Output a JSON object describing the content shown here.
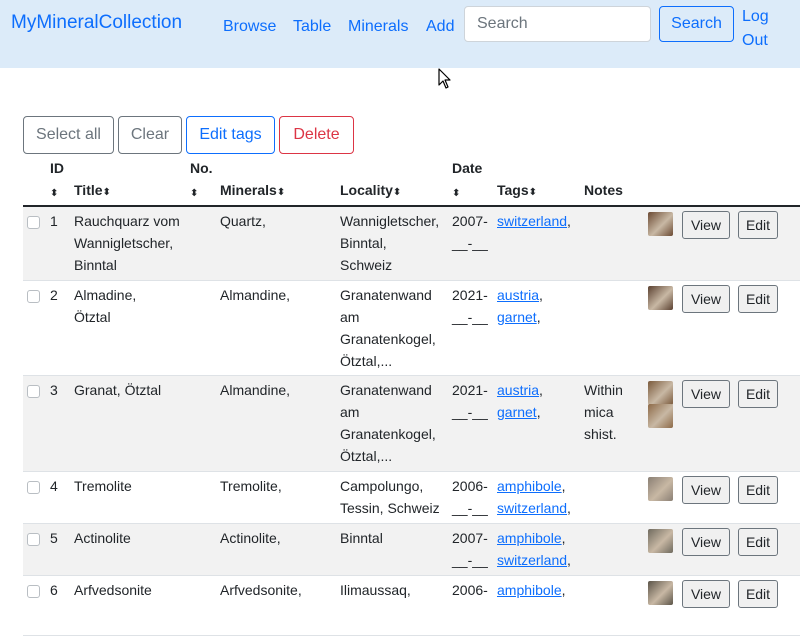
{
  "navbar": {
    "brand": "MyMineralCollection",
    "links": [
      "Browse",
      "Table",
      "Minerals",
      "Add"
    ],
    "search_placeholder": "Search",
    "search_button": "Search",
    "logout_line1": "Log",
    "logout_line2": "Out"
  },
  "actions": {
    "select_all": "Select all",
    "clear": "Clear",
    "edit_tags": "Edit tags",
    "delete": "Delete"
  },
  "table": {
    "headers": {
      "id": "ID",
      "title": "Title",
      "no": "No.",
      "minerals": "Minerals",
      "locality": "Locality",
      "date": "Date",
      "tags": "Tags",
      "notes": "Notes"
    },
    "sort_icon": "sort-arrows",
    "rows": [
      {
        "id": "1",
        "title_lines": [
          "Rauchquarz vom",
          "Wannigletscher,",
          "Binntal"
        ],
        "minerals": "Quartz,",
        "locality_lines": [
          "Wannigletscher,",
          "Binntal,",
          "Schweiz"
        ],
        "date_lines": [
          "2007-",
          "__-__"
        ],
        "tags": [
          "switzerland"
        ],
        "notes_lines": [],
        "thumbs": 1,
        "view": "View",
        "edit": "Edit"
      },
      {
        "id": "2",
        "title_lines": [
          "Almadine,",
          "Ötztal"
        ],
        "minerals": "Almandine,",
        "locality_lines": [
          "Granatenwand",
          "am",
          "Granatenkogel,",
          "Ötztal,..."
        ],
        "date_lines": [
          "2021-",
          "__-__"
        ],
        "tags": [
          "austria",
          "garnet"
        ],
        "notes_lines": [],
        "thumbs": 1,
        "view": "View",
        "edit": "Edit"
      },
      {
        "id": "3",
        "title_lines": [
          "Granat, Ötztal"
        ],
        "minerals": "Almandine,",
        "locality_lines": [
          "Granatenwand",
          "am",
          "Granatenkogel,",
          "Ötztal,..."
        ],
        "date_lines": [
          "2021-",
          "__-__"
        ],
        "tags": [
          "austria",
          "garnet"
        ],
        "notes_lines": [
          "Within",
          "mica",
          "shist."
        ],
        "thumbs": 2,
        "view": "View",
        "edit": "Edit"
      },
      {
        "id": "4",
        "title_lines": [
          "Tremolite"
        ],
        "minerals": "Tremolite,",
        "locality_lines": [
          "Campolungo,",
          "Tessin, Schweiz"
        ],
        "date_lines": [
          "2006-",
          "__-__"
        ],
        "tags": [
          "amphibole",
          "switzerland"
        ],
        "notes_lines": [],
        "thumbs": 1,
        "view": "View",
        "edit": "Edit"
      },
      {
        "id": "5",
        "title_lines": [
          "Actinolite"
        ],
        "minerals": "Actinolite,",
        "locality_lines": [
          "Binntal"
        ],
        "date_lines": [
          "2007-",
          "__-__"
        ],
        "tags": [
          "amphibole",
          "switzerland"
        ],
        "notes_lines": [],
        "thumbs": 1,
        "view": "View",
        "edit": "Edit"
      },
      {
        "id": "6",
        "title_lines": [
          "Arfvedsonite"
        ],
        "minerals": "Arfvedsonite,",
        "locality_lines": [
          "Ilimaussaq,"
        ],
        "date_lines": [
          "2006-"
        ],
        "tags": [
          "amphibole"
        ],
        "notes_lines": [],
        "thumbs": 1,
        "view": "View",
        "edit": "Edit"
      }
    ]
  }
}
